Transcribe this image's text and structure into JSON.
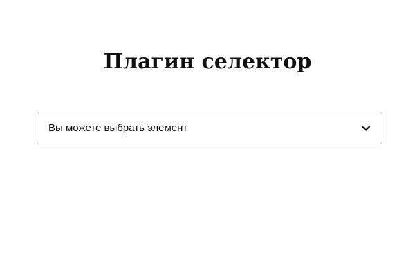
{
  "page": {
    "title": "Плагин селектор"
  },
  "selector": {
    "selected_value": "Вы можете выбрать элемент",
    "icon": "chevron-down-icon"
  }
}
